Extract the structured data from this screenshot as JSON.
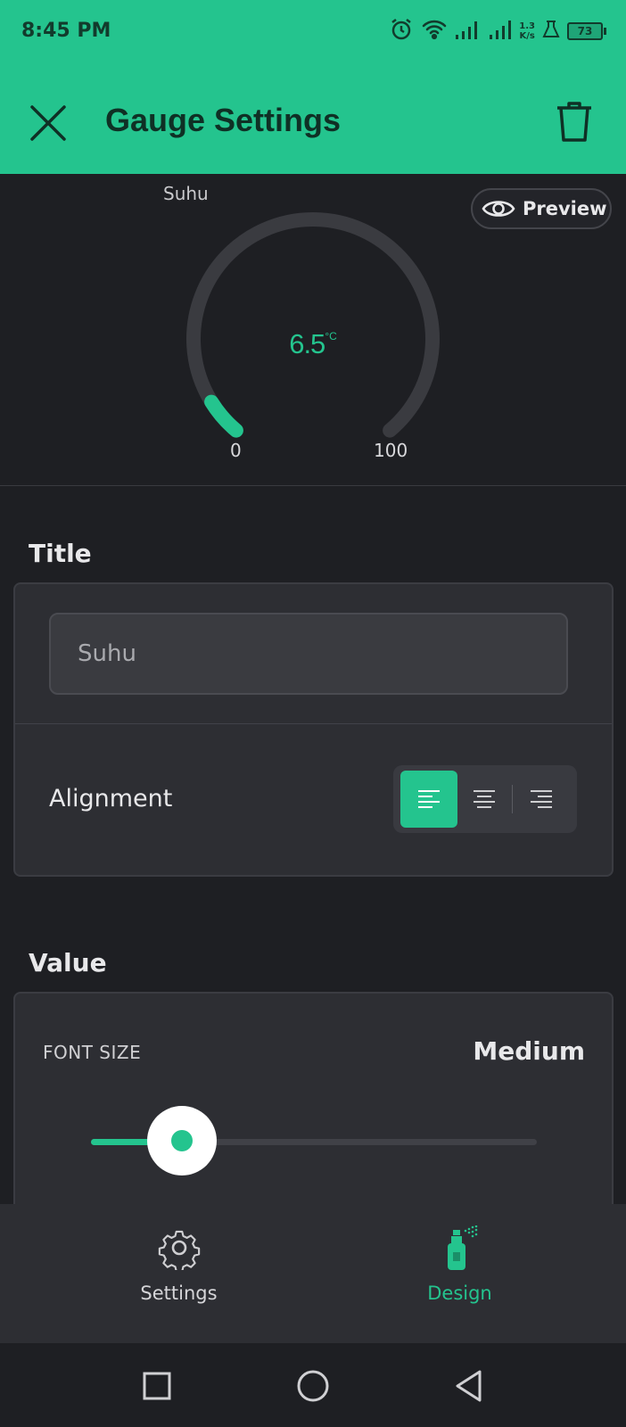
{
  "status_bar": {
    "time": "8:45 PM",
    "net_speed_value": "1.3",
    "net_speed_unit": "K/s",
    "battery": "73",
    "icons": [
      "alarm-icon",
      "wifi-icon",
      "signal-icon",
      "signal-icon",
      "flask-icon",
      "battery-icon"
    ]
  },
  "app_bar": {
    "title": "Gauge Settings",
    "close_icon": "close-icon",
    "delete_icon": "trash-icon"
  },
  "preview": {
    "widget_title": "Suhu",
    "preview_label": "Preview",
    "value": "6.5",
    "unit": "°C",
    "min": "0",
    "max": "100",
    "fill_fraction": 0.065,
    "accent_color": "#24c48e",
    "track_color": "#3a3b40"
  },
  "title_section": {
    "heading": "Title",
    "input_value": "Suhu",
    "alignment_label": "Alignment",
    "alignment_options": [
      "left",
      "center",
      "right"
    ],
    "alignment_selected": "left"
  },
  "value_section": {
    "heading": "Value",
    "font_size_label": "FONT SIZE",
    "font_size_value": "Medium",
    "slider_fraction": 0.21
  },
  "bottom_nav": {
    "items": [
      {
        "label": "Settings",
        "icon": "gear-icon",
        "active": false
      },
      {
        "label": "Design",
        "icon": "spray-can-icon",
        "active": true
      }
    ]
  },
  "system_nav": [
    "recents-icon",
    "home-icon",
    "back-icon"
  ],
  "colors": {
    "accent": "#24c48e",
    "background": "#1e1f23",
    "card": "#2d2e33"
  }
}
